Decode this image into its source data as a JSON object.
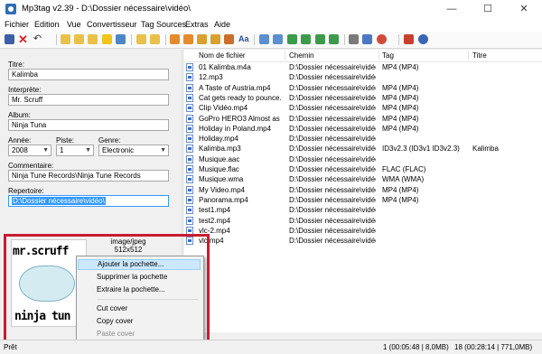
{
  "window": {
    "title": "Mp3tag v2.39  -  D:\\Dossier nécessaire\\vidéo\\",
    "minimize": "—",
    "maximize": "☐",
    "close": "✕"
  },
  "menu": [
    "Fichier",
    "Edition",
    "Vue",
    "Convertisseur",
    "Tag Sources",
    "Extras",
    "Aide"
  ],
  "toolbar_icons": [
    "save-icon",
    "remove-tag-icon",
    "undo-icon",
    "open-folder-icon",
    "add-folder-icon",
    "favorite-folder-icon",
    "star-icon",
    "select-all-icon",
    "tag-to-filename-icon",
    "filename-to-tag-icon",
    "text-to-tag-icon",
    "tag-to-tag-icon",
    "tag-sources-icon",
    "case-conversion-icon",
    "actions-icon",
    "edit-icon",
    "export-icon",
    "playlist-icon",
    "settings-icon",
    "help-icon"
  ],
  "tag_panel": {
    "title_label": "Titre:",
    "title_value": "Kalimba",
    "artist_label": "Interprète:",
    "artist_value": "Mr. Scruff",
    "album_label": "Album:",
    "album_value": "Ninja Tuna",
    "year_label": "Année:",
    "year_value": "2008",
    "track_label": "Piste:",
    "track_value": "1",
    "genre_label": "Genre:",
    "genre_value": "Electronic",
    "comment_label": "Commentaire:",
    "comment_value": "Ninja Tune Records\\Ninja Tune Records",
    "directory_label": "Repertoire:",
    "directory_value": "D:\\Dossier nécessaire\\vidéo\\",
    "cover": {
      "line1": "mr.scruff",
      "line2": "ninja tun",
      "format": "image/jpeg",
      "size": "512x512"
    }
  },
  "context_menu": {
    "items": [
      {
        "label": "Ajouter la pochette...",
        "state": "hover"
      },
      {
        "label": "Supprimer la pochette",
        "state": "normal"
      },
      {
        "label": "Extraire la pochette...",
        "state": "normal"
      },
      {
        "label": "Cut cover",
        "state": "normal"
      },
      {
        "label": "Copy cover",
        "state": "normal"
      },
      {
        "label": "Paste cover",
        "state": "disabled"
      }
    ]
  },
  "file_list": {
    "columns": [
      "Nom de fichier",
      "Chemin",
      "Tag",
      "Titre"
    ],
    "rows": [
      {
        "name": "01 Kalimba.m4a",
        "path": "D:\\Dossier nécessaire\\vidéo\\",
        "tag": "MP4 (MP4)",
        "title": ""
      },
      {
        "name": "12.mp3",
        "path": "D:\\Dossier nécessaire\\vidéo\\",
        "tag": "",
        "title": ""
      },
      {
        "name": "A Taste of Austria.mp4",
        "path": "D:\\Dossier nécessaire\\vidéo\\",
        "tag": "MP4 (MP4)",
        "title": ""
      },
      {
        "name": "Cat gets ready to pounce...",
        "path": "D:\\Dossier nécessaire\\vidéo\\",
        "tag": "MP4 (MP4)",
        "title": ""
      },
      {
        "name": "Clip Vidéo.mp4",
        "path": "D:\\Dossier nécessaire\\vidéo\\",
        "tag": "MP4 (MP4)",
        "title": ""
      },
      {
        "name": "GoPro HERO3 Almost as E...",
        "path": "D:\\Dossier nécessaire\\vidéo\\",
        "tag": "MP4 (MP4)",
        "title": ""
      },
      {
        "name": "Holiday in Poland.mp4",
        "path": "D:\\Dossier nécessaire\\vidéo\\",
        "tag": "MP4 (MP4)",
        "title": ""
      },
      {
        "name": "Holiday.mp4",
        "path": "D:\\Dossier nécessaire\\vidéo\\",
        "tag": "",
        "title": ""
      },
      {
        "name": "Kalimba.mp3",
        "path": "D:\\Dossier nécessaire\\vidéo\\",
        "tag": "ID3v2.3 (ID3v1 ID3v2.3)",
        "title": "Kalimba"
      },
      {
        "name": "Musique.aac",
        "path": "D:\\Dossier nécessaire\\vidéo\\",
        "tag": "",
        "title": ""
      },
      {
        "name": "Musique.flac",
        "path": "D:\\Dossier nécessaire\\vidéo\\",
        "tag": "FLAC (FLAC)",
        "title": ""
      },
      {
        "name": "Musique.wma",
        "path": "D:\\Dossier nécessaire\\vidéo\\",
        "tag": "WMA (WMA)",
        "title": ""
      },
      {
        "name": "My Video.mp4",
        "path": "D:\\Dossier nécessaire\\vidéo\\",
        "tag": "MP4 (MP4)",
        "title": ""
      },
      {
        "name": "Panorama.mp4",
        "path": "D:\\Dossier nécessaire\\vidéo\\",
        "tag": "MP4 (MP4)",
        "title": ""
      },
      {
        "name": "test1.mp4",
        "path": "D:\\Dossier nécessaire\\vidéo\\",
        "tag": "",
        "title": ""
      },
      {
        "name": "test2.mp4",
        "path": "D:\\Dossier nécessaire\\vidéo\\",
        "tag": "",
        "title": ""
      },
      {
        "name": "vlc-2.mp4",
        "path": "D:\\Dossier nécessaire\\vidéo\\",
        "tag": "",
        "title": ""
      },
      {
        "name": "vlc.mp4",
        "path": "D:\\Dossier nécessaire\\vidéo\\",
        "tag": "",
        "title": ""
      }
    ]
  },
  "status": {
    "left": "Prêt",
    "selection": "1 (00:05:48 | 8,0MB)",
    "total": "18 (00:28:14 | 771,0MB)"
  },
  "colors": {
    "highlight_frame": "#c81c32",
    "selection_blue": "#3399ff",
    "menu_hover": "#cce8ff"
  }
}
